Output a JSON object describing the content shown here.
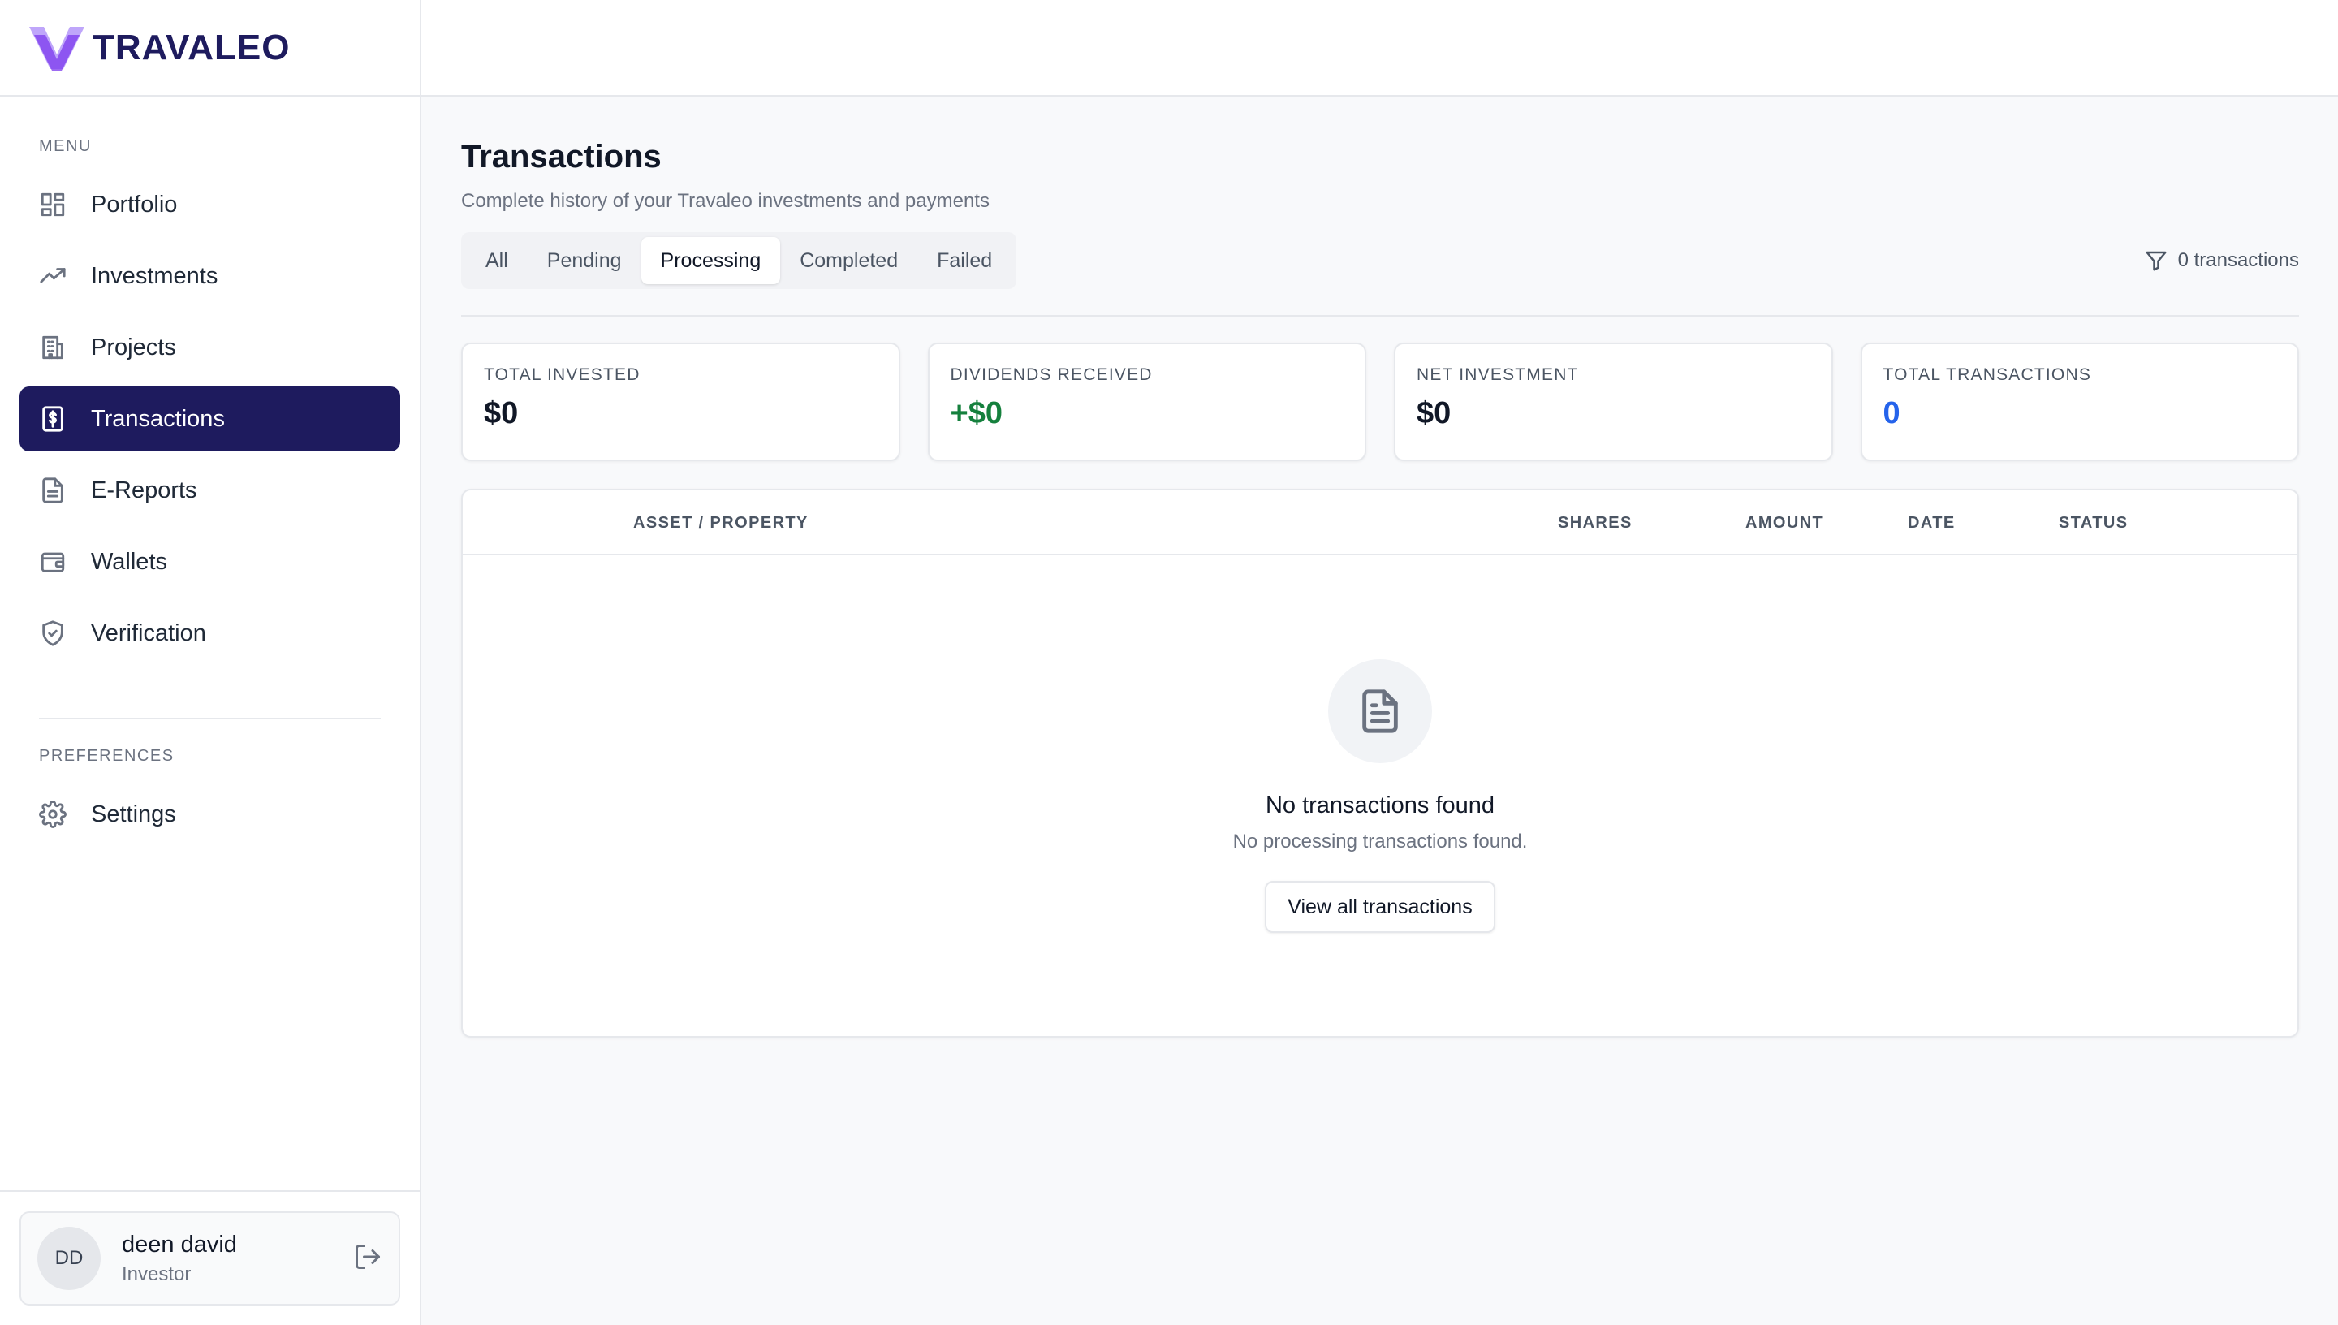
{
  "brand": {
    "name": "TRAVALEO",
    "logo_color": "#8b5cf6"
  },
  "sidebar": {
    "menu_label": "MENU",
    "items": [
      {
        "label": "Portfolio",
        "icon": "grid-icon"
      },
      {
        "label": "Investments",
        "icon": "trending-up-icon"
      },
      {
        "label": "Projects",
        "icon": "building-icon"
      },
      {
        "label": "Transactions",
        "icon": "dollar-receipt-icon",
        "active": true
      },
      {
        "label": "E-Reports",
        "icon": "file-text-icon"
      },
      {
        "label": "Wallets",
        "icon": "wallet-icon"
      },
      {
        "label": "Verification",
        "icon": "shield-check-icon"
      }
    ],
    "preferences_label": "PREFERENCES",
    "pref_items": [
      {
        "label": "Settings",
        "icon": "gear-icon"
      }
    ],
    "active_color": "#1e1b5e"
  },
  "user": {
    "initials": "DD",
    "name": "deen david",
    "role": "Investor"
  },
  "page": {
    "title": "Transactions",
    "subtitle": "Complete history of your Travaleo investments and payments"
  },
  "tabs": {
    "items": [
      "All",
      "Pending",
      "Processing",
      "Completed",
      "Failed"
    ],
    "active": "Processing"
  },
  "tx_count": "0 transactions",
  "stats": [
    {
      "label": "TOTAL INVESTED",
      "value": "$0"
    },
    {
      "label": "DIVIDENDS RECEIVED",
      "value": "+$0",
      "color": "#15803d"
    },
    {
      "label": "NET INVESTMENT",
      "value": "$0"
    },
    {
      "label": "TOTAL TRANSACTIONS",
      "value": "0",
      "color": "#2563eb"
    }
  ],
  "table": {
    "columns": [
      "ASSET / PROPERTY",
      "SHARES",
      "AMOUNT",
      "DATE",
      "STATUS"
    ],
    "rows": []
  },
  "empty_state": {
    "icon": "document-icon",
    "title": "No transactions found",
    "subtitle": "No processing transactions found.",
    "button": "View all transactions"
  }
}
